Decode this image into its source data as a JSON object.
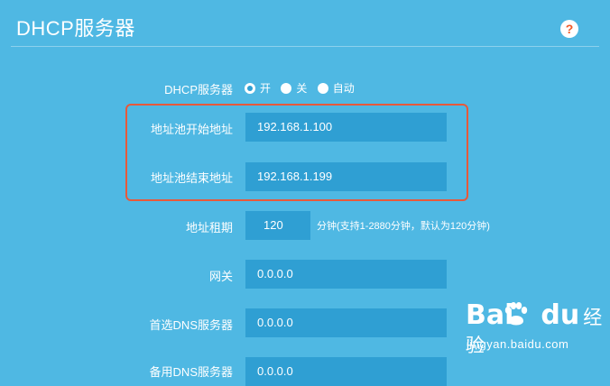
{
  "header": {
    "title": "DHCP服务器",
    "help_glyph": "?"
  },
  "form": {
    "dhcp_server": {
      "label": "DHCP服务器",
      "options": [
        "开",
        "关",
        "自动"
      ],
      "selected": "开"
    },
    "pool_start": {
      "label": "地址池开始地址",
      "value": "192.168.1.100"
    },
    "pool_end": {
      "label": "地址池结束地址",
      "value": "192.168.1.199"
    },
    "lease": {
      "label": "地址租期",
      "value": "120",
      "hint": "分钟(支持1-2880分钟，默认为120分钟)"
    },
    "gateway": {
      "label": "网关",
      "value": "0.0.0.0"
    },
    "primary_dns": {
      "label": "首选DNS服务器",
      "value": "0.0.0.0"
    },
    "secondary_dns": {
      "label": "备用DNS服务器",
      "value": "0.0.0.0"
    }
  },
  "watermark": {
    "brand": "Bai",
    "brand_suffix": "du",
    "sub": "经验",
    "url": "jingyan.baidu.com"
  },
  "colors": {
    "background": "#4fb8e3",
    "field": "#2f9fd3",
    "highlight": "#e8593a",
    "help_icon_fg": "#f05a28"
  }
}
